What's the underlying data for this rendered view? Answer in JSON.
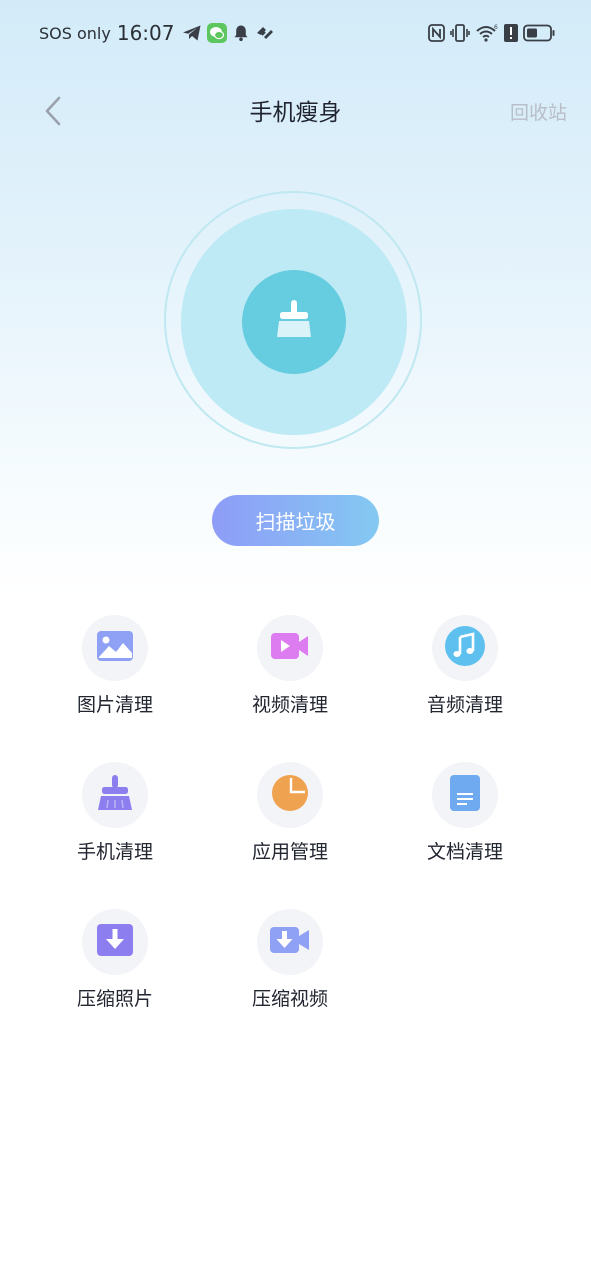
{
  "status_bar": {
    "carrier": "SOS only",
    "time": "16:07",
    "left_icons": [
      "telegram-icon",
      "wechat-icon",
      "bell-icon",
      "health-icon"
    ],
    "right_icons": [
      "nfc-icon",
      "vibrate-icon",
      "wifi-icon",
      "alert-icon",
      "battery-icon"
    ]
  },
  "header": {
    "title": "手机瘦身",
    "recycle_bin": "回收站"
  },
  "hero": {
    "icon": "broom-icon",
    "scan_button": "扫描垃圾"
  },
  "tools": [
    {
      "label": "图片清理",
      "icon": "image-icon"
    },
    {
      "label": "视频清理",
      "icon": "video-icon"
    },
    {
      "label": "音频清理",
      "icon": "music-icon"
    },
    {
      "label": "手机清理",
      "icon": "broom-icon"
    },
    {
      "label": "应用管理",
      "icon": "pie-chart-icon"
    },
    {
      "label": "文档清理",
      "icon": "document-icon"
    },
    {
      "label": "压缩照片",
      "icon": "compress-photo-icon"
    },
    {
      "label": "压缩视频",
      "icon": "compress-video-icon"
    }
  ],
  "colors": {
    "accent_cyan": "#66ccdf",
    "scan_gradient_start": "#8e9cf7",
    "scan_gradient_end": "#84c9f2",
    "purple": "#8d7ef0",
    "video_pink": "#dc7cf0",
    "music_blue": "#5ec0ee",
    "pie_orange": "#efa24f",
    "doc_blue": "#6fa9ef"
  }
}
